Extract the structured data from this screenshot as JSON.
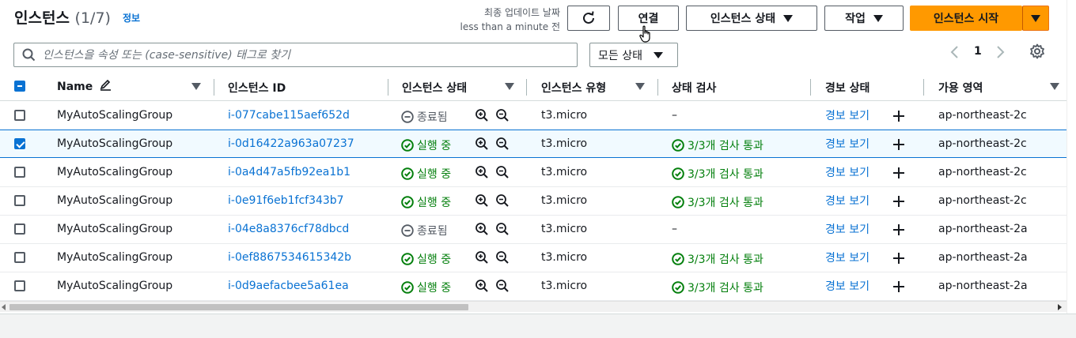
{
  "header": {
    "title": "인스턴스",
    "count": "(1/7)",
    "info_link": "정보",
    "last_updated_label": "최종 업데이트 날짜",
    "last_updated_value": "less than a minute 전"
  },
  "toolbar": {
    "connect_label": "연결",
    "instance_state_label": "인스턴스 상태",
    "actions_label": "작업",
    "launch_label": "인스턴스 시작"
  },
  "search": {
    "placeholder": "인스턴스을 속성 또는 (case-sensitive) 태그로 찾기"
  },
  "filter": {
    "state_filter_label": "모든 상태"
  },
  "pagination": {
    "current_page": "1"
  },
  "table": {
    "columns": {
      "name": "Name",
      "instance_id": "인스턴스 ID",
      "instance_state": "인스턴스 상태",
      "instance_type": "인스턴스 유형",
      "status_check": "상태 검사",
      "alarm_status": "경보 상태",
      "availability_zone": "가용 영역"
    },
    "rows": [
      {
        "name": "MyAutoScalingGroup",
        "id": "i-077cabe115aef652d",
        "state": "종료됨",
        "state_kind": "terminated",
        "type": "t3.micro",
        "check": "–",
        "check_kind": "none",
        "alarm": "경보 보기",
        "zone": "ap-northeast-2c",
        "selected": false
      },
      {
        "name": "MyAutoScalingGroup",
        "id": "i-0d16422a963a07237",
        "state": "실행 중",
        "state_kind": "running",
        "type": "t3.micro",
        "check": "3/3개 검사 통과",
        "check_kind": "passed",
        "alarm": "경보 보기",
        "zone": "ap-northeast-2c",
        "selected": true
      },
      {
        "name": "MyAutoScalingGroup",
        "id": "i-0a4d47a5fb92ea1b1",
        "state": "실행 중",
        "state_kind": "running",
        "type": "t3.micro",
        "check": "3/3개 검사 통과",
        "check_kind": "passed",
        "alarm": "경보 보기",
        "zone": "ap-northeast-2c",
        "selected": false
      },
      {
        "name": "MyAutoScalingGroup",
        "id": "i-0e91f6eb1fcf343b7",
        "state": "실행 중",
        "state_kind": "running",
        "type": "t3.micro",
        "check": "3/3개 검사 통과",
        "check_kind": "passed",
        "alarm": "경보 보기",
        "zone": "ap-northeast-2c",
        "selected": false
      },
      {
        "name": "MyAutoScalingGroup",
        "id": "i-04e8a8376cf78dbcd",
        "state": "종료됨",
        "state_kind": "terminated",
        "type": "t3.micro",
        "check": "–",
        "check_kind": "none",
        "alarm": "경보 보기",
        "zone": "ap-northeast-2a",
        "selected": false
      },
      {
        "name": "MyAutoScalingGroup",
        "id": "i-0ef8867534615342b",
        "state": "실행 중",
        "state_kind": "running",
        "type": "t3.micro",
        "check": "3/3개 검사 통과",
        "check_kind": "passed",
        "alarm": "경보 보기",
        "zone": "ap-northeast-2a",
        "selected": false
      },
      {
        "name": "MyAutoScalingGroup",
        "id": "i-0d9aefacbee5a61ea",
        "state": "실행 중",
        "state_kind": "running",
        "type": "t3.micro",
        "check": "3/3개 검사 통과",
        "check_kind": "passed",
        "alarm": "경보 보기",
        "zone": "ap-northeast-2a",
        "selected": false
      }
    ]
  },
  "colors": {
    "primary_button": "#ff9900",
    "link": "#0972d3",
    "success": "#037f0c",
    "muted": "#545b64"
  },
  "icons": {
    "refresh": "refresh-icon",
    "search": "search-icon",
    "settings": "gear-icon",
    "edit": "pencil-icon",
    "running": "check-circle-icon",
    "terminated": "minus-circle-icon",
    "zoom_in": "zoom-in-icon",
    "zoom_out": "zoom-out-icon",
    "add": "plus-icon"
  }
}
